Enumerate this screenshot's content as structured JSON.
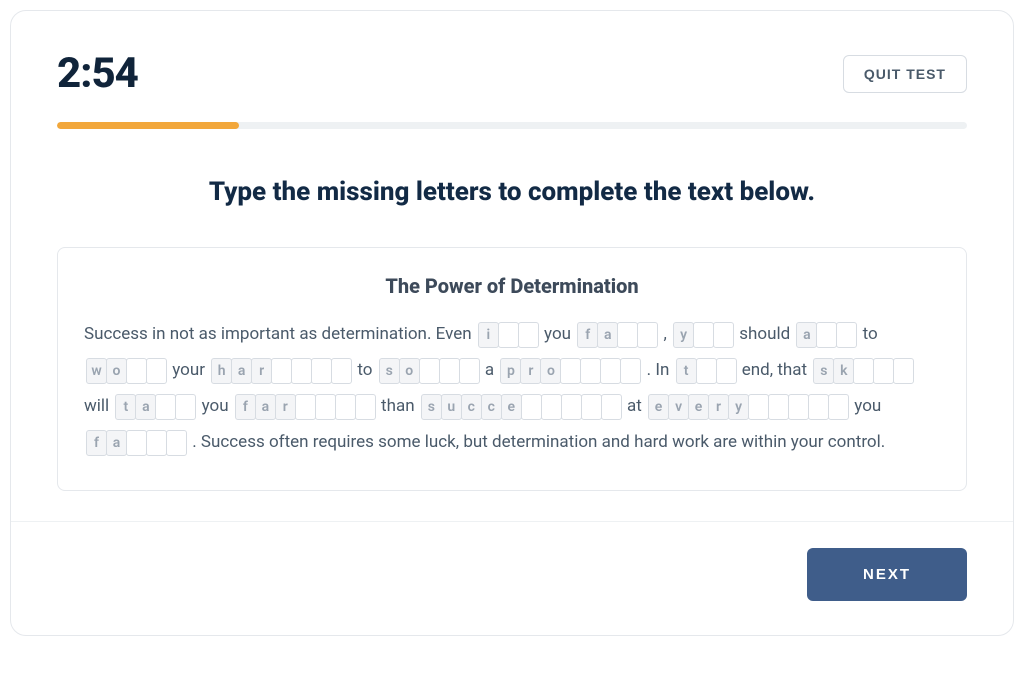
{
  "timer": "2:54",
  "quit_label": "QUIT TEST",
  "progress_percent": 20,
  "instruction": "Type the missing letters to complete the text below.",
  "passage_title": "The Power of Determination",
  "next_label": "NEXT",
  "segments": [
    {
      "type": "text",
      "value": "Success in not as important as determination. Even "
    },
    {
      "type": "word",
      "cells": [
        "i",
        "",
        ""
      ]
    },
    {
      "type": "text",
      "value": " you "
    },
    {
      "type": "word",
      "cells": [
        "f",
        "a",
        "",
        ""
      ]
    },
    {
      "type": "text",
      "value": " , "
    },
    {
      "type": "word",
      "cells": [
        "y",
        "",
        ""
      ]
    },
    {
      "type": "text",
      "value": " should "
    },
    {
      "type": "word",
      "cells": [
        "a",
        "",
        ""
      ]
    },
    {
      "type": "text",
      "value": " to "
    },
    {
      "type": "word",
      "cells": [
        "w",
        "o",
        "",
        ""
      ]
    },
    {
      "type": "text",
      "value": " your "
    },
    {
      "type": "word",
      "cells": [
        "h",
        "a",
        "r",
        "",
        "",
        "",
        ""
      ]
    },
    {
      "type": "text",
      "value": " to "
    },
    {
      "type": "word",
      "cells": [
        "s",
        "o",
        "",
        "",
        ""
      ]
    },
    {
      "type": "text",
      "value": " a "
    },
    {
      "type": "word",
      "cells": [
        "p",
        "r",
        "o",
        "",
        "",
        "",
        ""
      ]
    },
    {
      "type": "text",
      "value": " . In "
    },
    {
      "type": "word",
      "cells": [
        "t",
        "",
        ""
      ]
    },
    {
      "type": "text",
      "value": " end, that "
    },
    {
      "type": "word",
      "cells": [
        "s",
        "k",
        "",
        "",
        ""
      ]
    },
    {
      "type": "text",
      "value": " will "
    },
    {
      "type": "word",
      "cells": [
        "t",
        "a",
        "",
        ""
      ]
    },
    {
      "type": "text",
      "value": " you "
    },
    {
      "type": "word",
      "cells": [
        "f",
        "a",
        "r",
        "",
        "",
        "",
        ""
      ]
    },
    {
      "type": "text",
      "value": " than "
    },
    {
      "type": "word",
      "cells": [
        "s",
        "u",
        "c",
        "c",
        "e",
        "",
        "",
        "",
        "",
        ""
      ]
    },
    {
      "type": "text",
      "value": " at "
    },
    {
      "type": "word",
      "cells": [
        "e",
        "v",
        "e",
        "r",
        "y",
        "",
        "",
        "",
        "",
        ""
      ]
    },
    {
      "type": "text",
      "value": " you "
    },
    {
      "type": "word",
      "cells": [
        "f",
        "a",
        "",
        "",
        ""
      ]
    },
    {
      "type": "text",
      "value": " . Success often requires some luck, but determination and hard work are within your control."
    }
  ]
}
